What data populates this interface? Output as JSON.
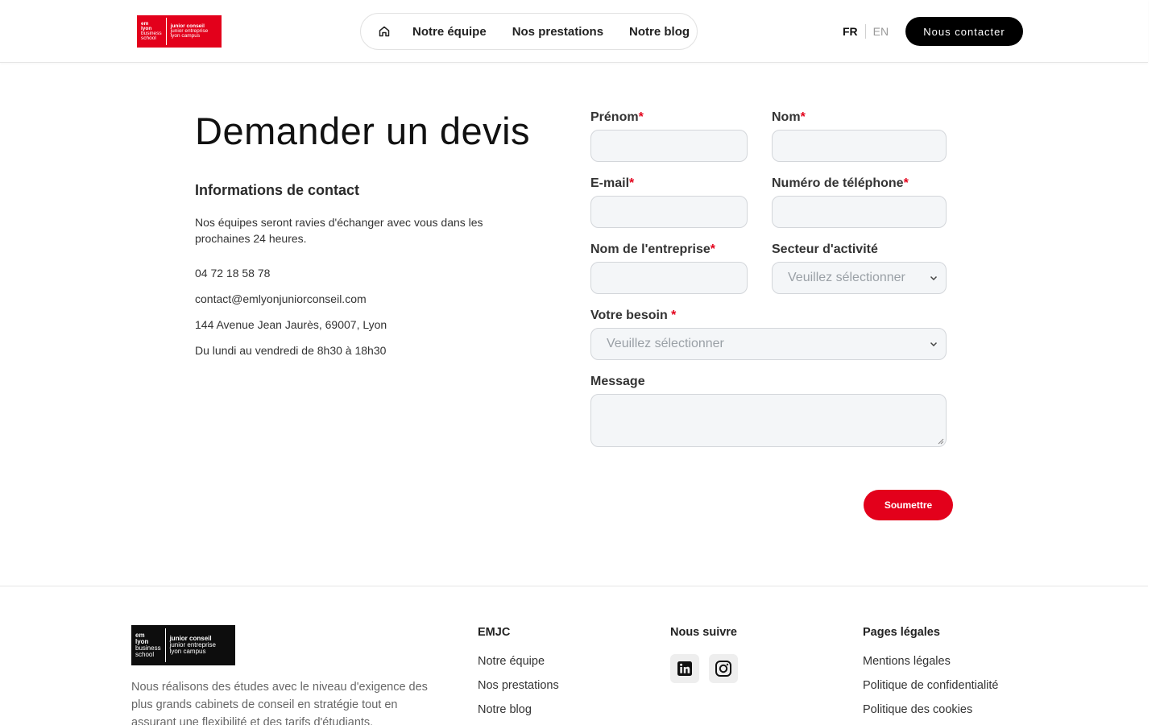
{
  "header": {
    "logo": {
      "left": [
        "em",
        "lyon",
        "business",
        "school"
      ],
      "right": [
        "junior conseil",
        "junior entreprise",
        "lyon campus"
      ]
    },
    "nav": {
      "home_icon": "home-icon",
      "items": [
        "Notre équipe",
        "Nos prestations",
        "Notre blog"
      ]
    },
    "lang": {
      "active": "FR",
      "other": "EN"
    },
    "contact_button": "Nous contacter"
  },
  "left": {
    "title": "Demander un devis",
    "info_title": "Informations de contact",
    "description": "Nos équipes seront ravies d'échanger avec vous dans les prochaines 24 heures.",
    "phone": "04 72 18 58 78",
    "email": "contact@emlyonjuniorconseil.com",
    "address": "144 Avenue Jean Jaurès, 69007, Lyon",
    "hours": "Du lundi au vendredi de 8h30 à 18h30"
  },
  "form": {
    "required_mark": "*",
    "first_name": {
      "label": "Prénom",
      "value": ""
    },
    "last_name": {
      "label": "Nom",
      "value": ""
    },
    "email": {
      "label": "E-mail",
      "value": ""
    },
    "phone": {
      "label": "Numéro de téléphone",
      "value": ""
    },
    "company": {
      "label": "Nom de l'entreprise",
      "value": ""
    },
    "sector": {
      "label": "Secteur d'activité",
      "selected": "Veuillez sélectionner"
    },
    "need": {
      "label": "Votre besoin ",
      "selected": "Veuillez sélectionner"
    },
    "message": {
      "label": "Message",
      "value": ""
    },
    "submit": "Soumettre"
  },
  "footer": {
    "logo": {
      "left": [
        "em",
        "lyon",
        "business",
        "school"
      ],
      "right": [
        "junior conseil",
        "junior entreprise",
        "lyon campus"
      ]
    },
    "description": "Nous réalisons des études avec le niveau d'exigence des plus grands cabinets de conseil en stratégie tout en assurant une flexibilité et des tarifs d'étudiants.",
    "emjc": {
      "title": "EMJC",
      "links": [
        "Notre équipe",
        "Nos prestations",
        "Notre blog"
      ]
    },
    "follow": {
      "title": "Nous suivre",
      "icons": [
        "linkedin-icon",
        "instagram-icon"
      ]
    },
    "legal": {
      "title": "Pages légales",
      "links": [
        "Mentions légales",
        "Politique de confidentialité",
        "Politique des cookies"
      ]
    }
  },
  "colors": {
    "brand_red": "#e3001b",
    "black": "#000000",
    "field_bg": "#f4f6f8"
  }
}
